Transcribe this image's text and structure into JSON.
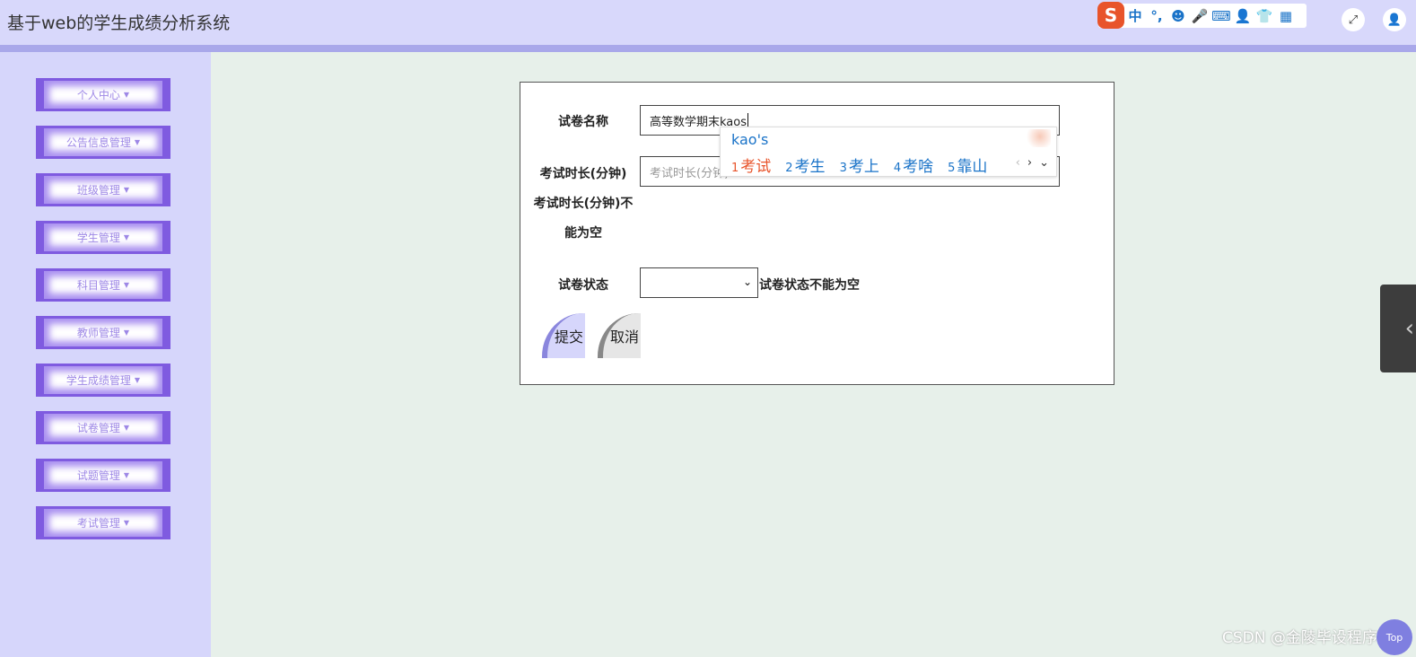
{
  "header": {
    "title": "基于web的学生成绩分析系统",
    "ime_toolbar": {
      "logo": "S",
      "items": [
        "中",
        "°,",
        "☻",
        "🎤",
        "⌨",
        "👤",
        "👕",
        "▦"
      ]
    },
    "fullscreen_icon": "⤢",
    "user_icon": "👤"
  },
  "sidebar": {
    "items": [
      {
        "label": "个人中心"
      },
      {
        "label": "公告信息管理"
      },
      {
        "label": "班级管理"
      },
      {
        "label": "学生管理"
      },
      {
        "label": "科目管理"
      },
      {
        "label": "教师管理"
      },
      {
        "label": "学生成绩管理"
      },
      {
        "label": "试卷管理"
      },
      {
        "label": "试题管理"
      },
      {
        "label": "考试管理"
      }
    ],
    "caret": "▼"
  },
  "form": {
    "name_label": "试卷名称",
    "name_value": "高等数学期末kaos",
    "duration_label": "考试时长(分钟)",
    "duration_placeholder": "考试时长(分钟)",
    "duration_error_line1": "考试时长(分钟)不",
    "duration_error_line2": "能为空",
    "status_label": "试卷状态",
    "status_value": "",
    "status_error": "试卷状态不能为空",
    "submit_label": "提交",
    "cancel_label": "取消"
  },
  "ime_popup": {
    "pinyin": "kao's",
    "candidates": [
      {
        "n": "1",
        "text": "考试"
      },
      {
        "n": "2",
        "text": "考生"
      },
      {
        "n": "3",
        "text": "考上"
      },
      {
        "n": "4",
        "text": "考啥"
      },
      {
        "n": "5",
        "text": "靠山"
      }
    ],
    "nav": [
      "‹",
      "›",
      "⌄"
    ]
  },
  "side_handle": "‹",
  "watermark": "CSDN @金陵毕设程序",
  "top_button": "Top"
}
